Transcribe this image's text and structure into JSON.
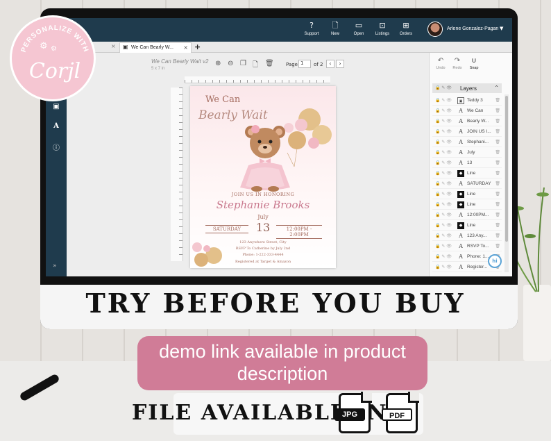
{
  "badge": {
    "arc_text": "PERSONALIZE WITH",
    "logo": "Corjl"
  },
  "topbar": {
    "buttons": [
      {
        "label": "Support",
        "icon": "question-circle-icon"
      },
      {
        "label": "New",
        "icon": "new-file-icon"
      },
      {
        "label": "Open",
        "icon": "folder-icon"
      },
      {
        "label": "Listings",
        "icon": "box-icon"
      },
      {
        "label": "Orders",
        "icon": "cart-icon"
      }
    ],
    "user_name": "Arlene Gonzalez-Pagan"
  },
  "tabs": {
    "active_label": "We Can Bearly W..."
  },
  "canvas": {
    "doc_name": "We Can Bearly Wait v2",
    "doc_size": "5 x 7 in",
    "page_label": "Page",
    "page_value": "1",
    "page_of": "of 2"
  },
  "card": {
    "line1": "We Can",
    "line2": "Bearly Wait",
    "join": "JOIN US IN HONORING",
    "name": "Stephanie Brooks",
    "month": "July",
    "day": "13",
    "dow": "SATURDAY",
    "time": "12:00PM - 2:00PM",
    "address1": "123 Anywhere Street, City",
    "address2": "RSVP To Catherine by July 2nd",
    "phone": "Phone: 1-222-333-4444",
    "registry": "Registered at Target & Amazon"
  },
  "right_panel": {
    "undo": "Undo",
    "redo": "Redo",
    "snap": "Snap",
    "layers_title": "Layers",
    "layers": [
      {
        "kind": "img",
        "name": "Teddy 3"
      },
      {
        "kind": "text",
        "name": "We Can"
      },
      {
        "kind": "text",
        "name": "Bearly W..."
      },
      {
        "kind": "text",
        "name": "JOIN US I..."
      },
      {
        "kind": "text",
        "name": "Stephani..."
      },
      {
        "kind": "text",
        "name": "July"
      },
      {
        "kind": "text",
        "name": "13"
      },
      {
        "kind": "shape",
        "name": "Line"
      },
      {
        "kind": "text",
        "name": "SATURDAY"
      },
      {
        "kind": "shape",
        "name": "Line"
      },
      {
        "kind": "shape",
        "name": "Line"
      },
      {
        "kind": "text",
        "name": "12:00PM..."
      },
      {
        "kind": "shape",
        "name": "Line"
      },
      {
        "kind": "text",
        "name": "123 Any..."
      },
      {
        "kind": "text",
        "name": "RSVP To..."
      },
      {
        "kind": "text",
        "name": "Phone: 1..."
      },
      {
        "kind": "text",
        "name": "Register..."
      }
    ]
  },
  "headline": "TRY BEFORE YOU BUY",
  "pill": {
    "line1": "demo link available in product",
    "line2": "description"
  },
  "file": {
    "text": "FILE AVAILABLE IN",
    "formats": [
      "JPG",
      "PDF"
    ]
  },
  "colors": {
    "accent_pink": "#d07c97",
    "app_navy": "#1f3b4d",
    "badge_pink": "#f5c6d2"
  }
}
